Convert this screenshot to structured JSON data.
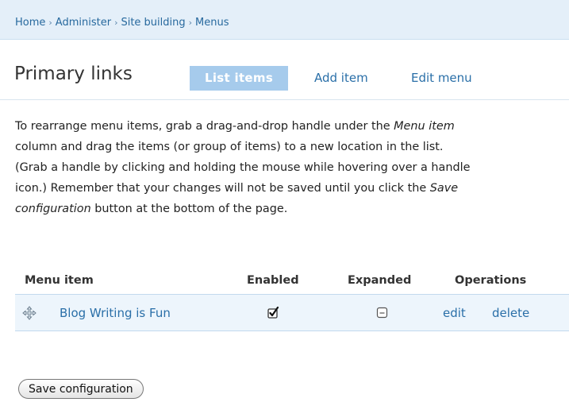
{
  "breadcrumb": {
    "items": [
      "Home",
      "Administer",
      "Site building",
      "Menus"
    ],
    "separator": "›"
  },
  "page": {
    "title": "Primary links"
  },
  "tabs": [
    {
      "label": "List items",
      "active": true
    },
    {
      "label": "Add item",
      "active": false
    },
    {
      "label": "Edit menu",
      "active": false
    }
  ],
  "help": {
    "line1_a": "To rearrange menu items, grab a drag-and-drop handle under the ",
    "line1_em": "Menu item",
    "line2": "column and drag the items (or group of items) to a new location in the list.",
    "line3": "(Grab a handle by clicking and holding the mouse while hovering over a handle",
    "line4_a": "icon.) Remember that your changes will not be saved until you click the ",
    "line4_em": "Save",
    "line5_em": "configuration",
    "line5_b": " button at the bottom of the page."
  },
  "table": {
    "headers": {
      "menu_item": "Menu item",
      "enabled": "Enabled",
      "expanded": "Expanded",
      "operations": "Operations"
    },
    "rows": [
      {
        "title": "Blog Writing is Fun",
        "enabled": true,
        "expanded": false,
        "edit": "edit",
        "delete": "delete"
      }
    ]
  },
  "actions": {
    "save_label": "Save configuration"
  },
  "icons": {
    "drag_handle": "drag-handle-icon"
  },
  "colors": {
    "link": "#2a6fa8",
    "breadcrumb_bg": "#e4eff9",
    "active_tab_bg": "#a6cbec",
    "row_bg": "#edf5fc"
  }
}
